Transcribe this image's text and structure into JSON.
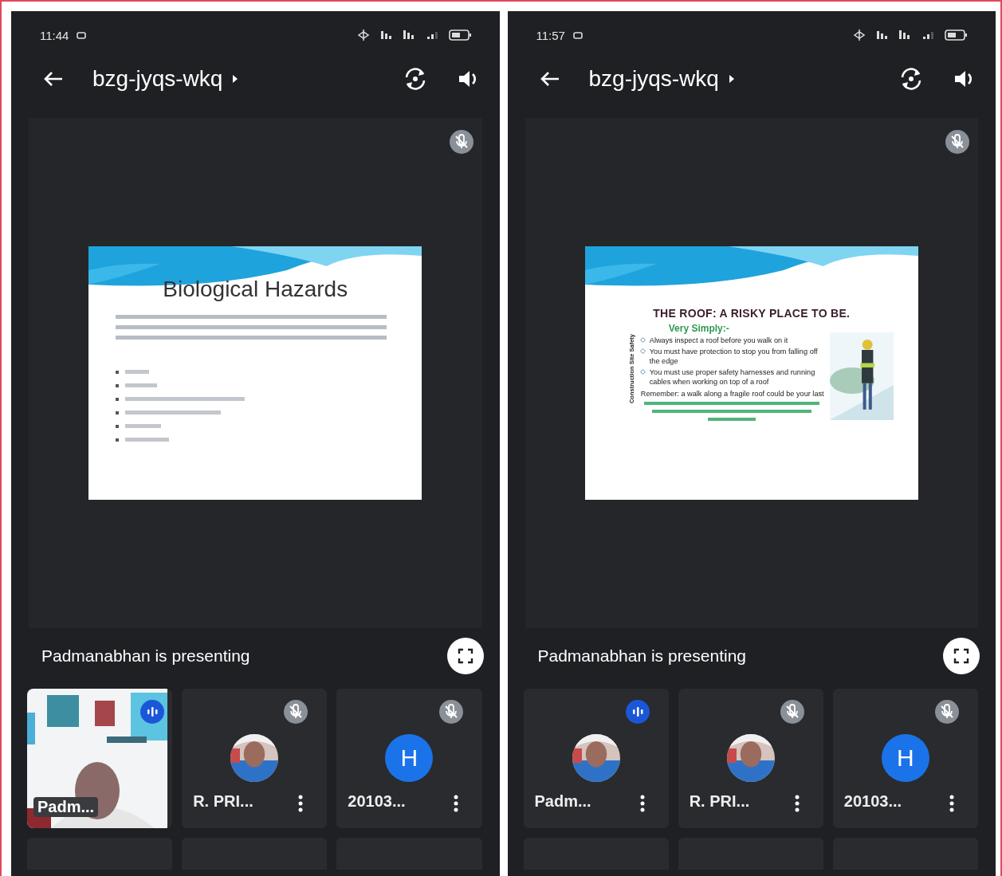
{
  "phones": [
    {
      "status": {
        "time": "11:44"
      },
      "meeting_code": "bzg-jyqs-wkq",
      "slide": {
        "kind": "text",
        "title": "Biological Hazards"
      },
      "presenting": "Padmanabhan is presenting",
      "participants": [
        {
          "kind": "video",
          "name": "Padm...",
          "muted": false
        },
        {
          "name": "R. PRI...",
          "muted": true
        },
        {
          "kind": "initial",
          "initial": "H",
          "name": "20103...",
          "muted": true
        }
      ]
    },
    {
      "status": {
        "time": "11:57"
      },
      "meeting_code": "bzg-jyqs-wkq",
      "slide": {
        "kind": "roof",
        "title": "THE ROOF: A RISKY PLACE TO BE.",
        "subtitle": "Very Simply:-",
        "side_label": "Construction Site Safety",
        "bullets": [
          "Always inspect a roof before you walk on it",
          "You must have protection to stop you from falling off the edge",
          "You must use proper safety harnesses and running cables when working on top of a roof"
        ],
        "note": "Remember: a walk along a fragile roof could be your last"
      },
      "presenting": "Padmanabhan is presenting",
      "participants": [
        {
          "name": "Padm...",
          "muted": false
        },
        {
          "name": "R. PRI...",
          "muted": true
        },
        {
          "kind": "initial",
          "initial": "H",
          "name": "20103...",
          "muted": true
        }
      ]
    }
  ]
}
